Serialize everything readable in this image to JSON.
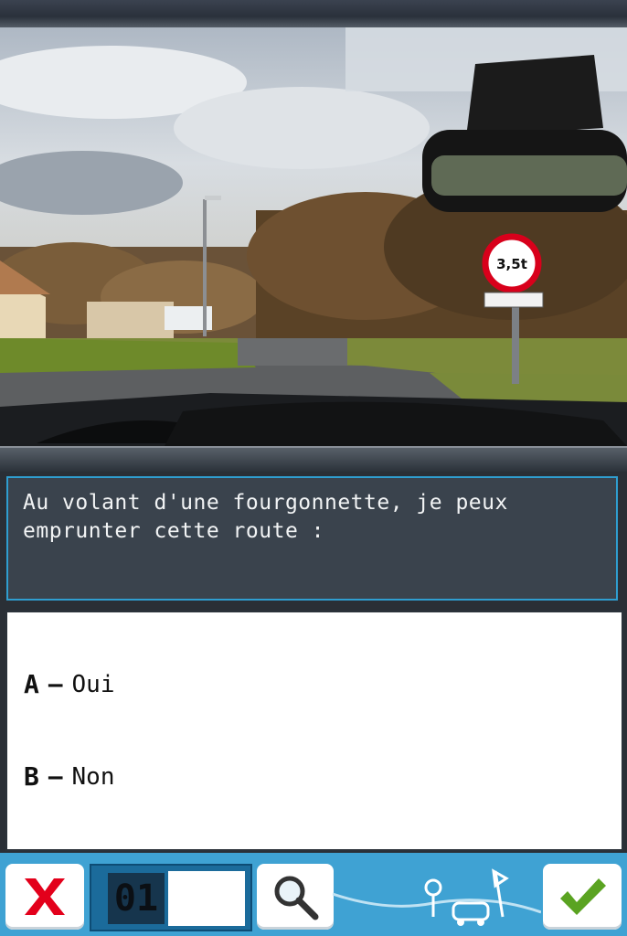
{
  "question": {
    "text_line1": "Au volant d'une fourgonnette, je peux",
    "text_line2": "emprunter cette route :"
  },
  "answers": [
    {
      "letter": "A",
      "label": "Oui"
    },
    {
      "letter": "B",
      "label": "Non"
    }
  ],
  "toolbar": {
    "question_number": "01"
  },
  "scene": {
    "sign_text": "3,5t"
  },
  "colors": {
    "accent": "#3fa2d3",
    "cancel": "#e3001b",
    "validate": "#5aa321",
    "panel": "#3a434d"
  },
  "icons": [
    "close-icon",
    "magnifier-icon",
    "checkmark-icon"
  ]
}
